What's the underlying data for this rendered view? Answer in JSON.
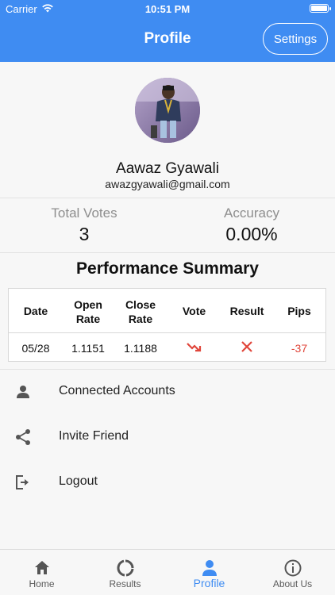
{
  "status_bar": {
    "carrier": "Carrier",
    "time": "10:51 PM"
  },
  "header": {
    "title": "Profile",
    "settings_label": "Settings"
  },
  "profile": {
    "name": "Aawaz Gyawali",
    "email": "awazgyawali@gmail.com"
  },
  "stats": {
    "total_votes_label": "Total Votes",
    "total_votes_value": "3",
    "accuracy_label": "Accuracy",
    "accuracy_value": "0.00%"
  },
  "performance": {
    "title": "Performance Summary",
    "columns": {
      "date": "Date",
      "open_rate_1": "Open",
      "open_rate_2": "Rate",
      "close_rate_1": "Close",
      "close_rate_2": "Rate",
      "vote": "Vote",
      "result": "Result",
      "pips": "Pips"
    },
    "rows": [
      {
        "date": "05/28",
        "open_rate": "1.1151",
        "close_rate": "1.1188",
        "vote_icon": "trend-down-icon",
        "result_icon": "cross-icon",
        "pips": "-37"
      }
    ]
  },
  "menu": [
    {
      "label": "Connected Accounts",
      "icon": "person-icon"
    },
    {
      "label": "Invite Friend",
      "icon": "share-icon"
    },
    {
      "label": "Logout",
      "icon": "logout-icon"
    }
  ],
  "tabs": [
    {
      "label": "Home",
      "icon": "home-icon"
    },
    {
      "label": "Results",
      "icon": "results-icon"
    },
    {
      "label": "Profile",
      "icon": "profile-icon"
    },
    {
      "label": "About Us",
      "icon": "info-icon"
    }
  ],
  "colors": {
    "accent": "#3f8cf2",
    "negative": "#e0463b"
  }
}
